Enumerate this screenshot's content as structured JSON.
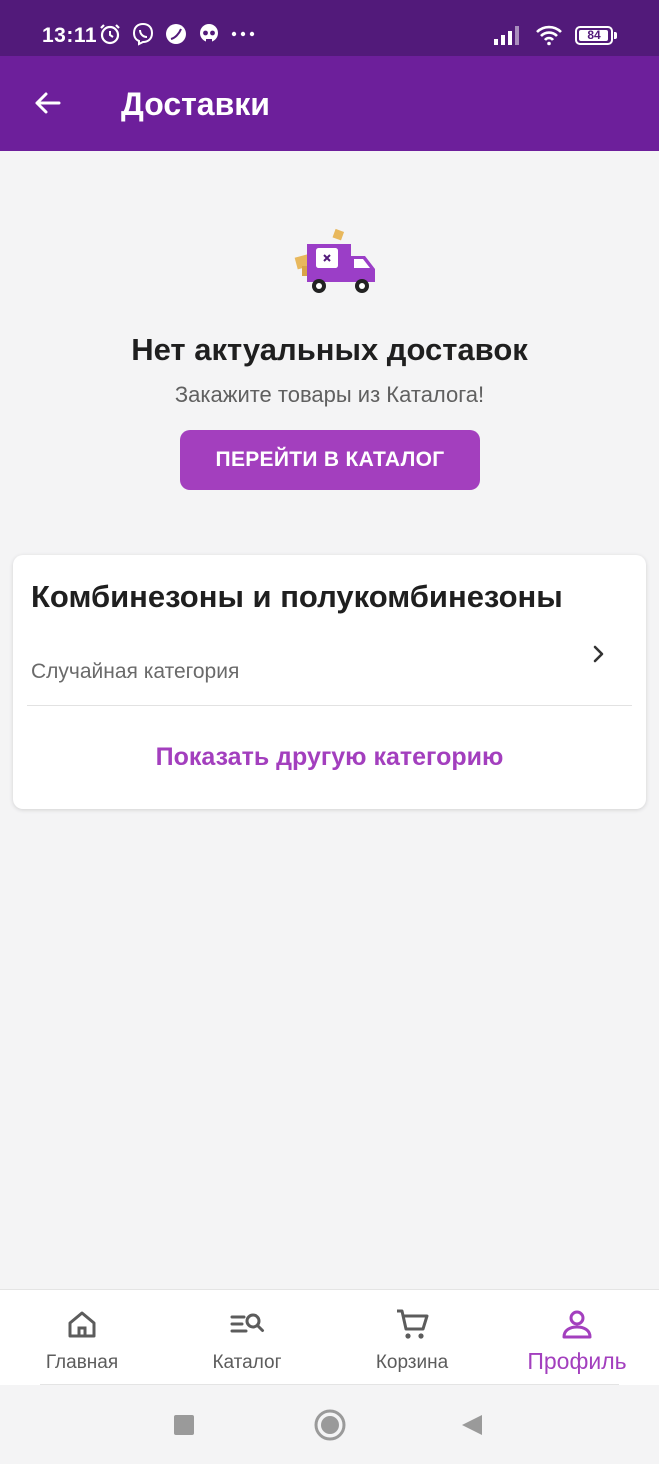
{
  "status_bar": {
    "time": "13:11",
    "battery": "84",
    "left_icons": [
      "alarm-icon",
      "viber-icon",
      "leaf-icon",
      "skull-icon",
      "more-dots-icon"
    ],
    "right_icons": [
      "signal-icon",
      "wifi-icon",
      "battery-icon"
    ]
  },
  "app_bar": {
    "title": "Доставки",
    "back_icon": "arrow-left-icon",
    "color": "#6d1f9b"
  },
  "empty_state": {
    "illustration": "delivery-truck-icon",
    "title": "Нет актуальных доставок",
    "subtitle": "Закажите товары из Каталога!",
    "button_label": "ПЕРЕЙТИ В КАТАЛОГ",
    "button_color": "#a33fbe"
  },
  "category_card": {
    "title": "Комбинезоны и полукомбинезоны",
    "subtitle": "Случайная категория",
    "action_label": "Показать другую категорию"
  },
  "bottom_nav": {
    "items": [
      {
        "label": "Главная",
        "icon": "home-icon",
        "active": false
      },
      {
        "label": "Каталог",
        "icon": "catalog-search-icon",
        "active": false
      },
      {
        "label": "Корзина",
        "icon": "cart-icon",
        "active": false
      },
      {
        "label": "Профиль",
        "icon": "profile-icon",
        "active": true
      }
    ],
    "active_color": "#a33fbe"
  },
  "system_nav": {
    "buttons": [
      "recents-square-icon",
      "home-circle-icon",
      "back-triangle-icon"
    ]
  }
}
